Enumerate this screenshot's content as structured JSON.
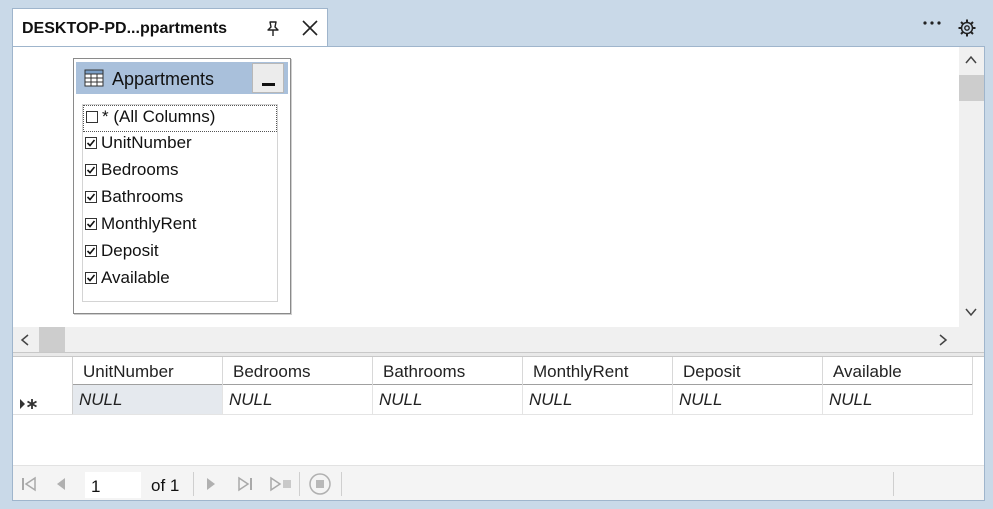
{
  "tab": {
    "title": "DESKTOP-PD...ppartments"
  },
  "table_box": {
    "name": "Appartments",
    "columns": [
      {
        "label": "* (All Columns)",
        "checked": false
      },
      {
        "label": "UnitNumber",
        "checked": true
      },
      {
        "label": "Bedrooms",
        "checked": true
      },
      {
        "label": "Bathrooms",
        "checked": true
      },
      {
        "label": "MonthlyRent",
        "checked": true
      },
      {
        "label": "Deposit",
        "checked": true
      },
      {
        "label": "Available",
        "checked": true
      }
    ]
  },
  "grid": {
    "headers": [
      "UnitNumber",
      "Bedrooms",
      "Bathrooms",
      "MonthlyRent",
      "Deposit",
      "Available"
    ],
    "row": [
      "NULL",
      "NULL",
      "NULL",
      "NULL",
      "NULL",
      "NULL"
    ],
    "row_marker": "▸*"
  },
  "navigator": {
    "page": "1",
    "of_label": "of 1"
  },
  "colors": {
    "chrome": "#c9d9e8",
    "table_header": "#a9c0db",
    "active_cell": "#e5e9ee"
  }
}
